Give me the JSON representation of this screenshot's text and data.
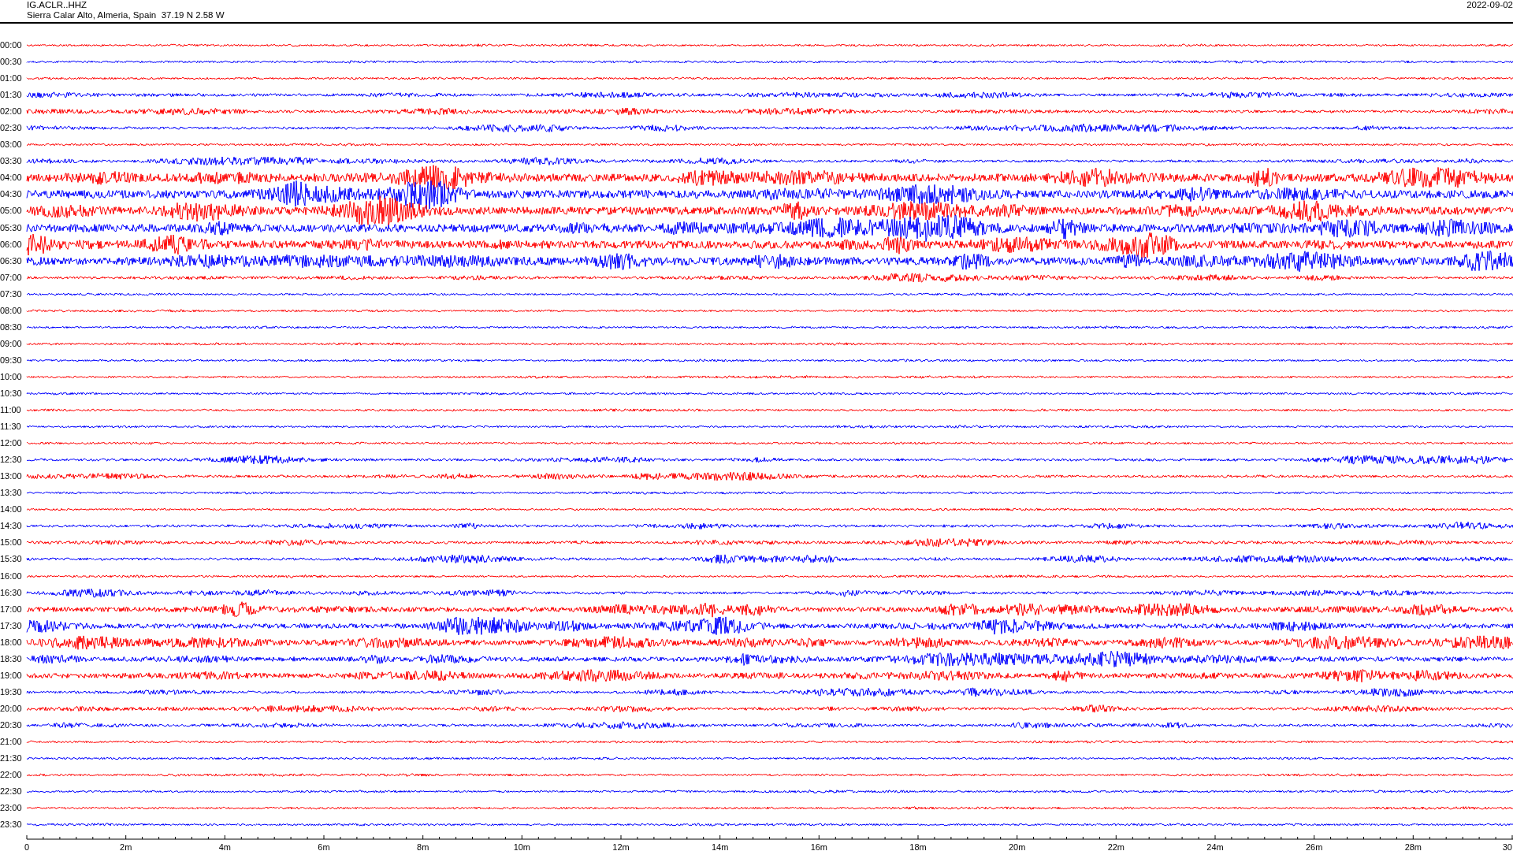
{
  "header": {
    "station": "IG.ACLR..HHZ",
    "location": "Sierra Calar Alto, Almeria, Spain  37.19 N 2.58 W",
    "date": "2022-09-02"
  },
  "traces": [
    {
      "label": "00:00",
      "color": "#ff0000",
      "kind": "quiet"
    },
    {
      "label": "00:30",
      "color": "#0000ff",
      "kind": "quiet"
    },
    {
      "label": "01:00",
      "color": "#ff0000",
      "kind": "quiet"
    },
    {
      "label": "01:30",
      "color": "#0000ff",
      "kind": "light"
    },
    {
      "label": "02:00",
      "color": "#ff0000",
      "kind": "light"
    },
    {
      "label": "02:30",
      "color": "#0000ff",
      "kind": "light"
    },
    {
      "label": "03:00",
      "color": "#ff0000",
      "kind": "quiet"
    },
    {
      "label": "03:30",
      "color": "#0000ff",
      "kind": "light"
    },
    {
      "label": "04:00",
      "color": "#ff0000",
      "kind": "strong"
    },
    {
      "label": "04:30",
      "color": "#0000ff",
      "kind": "strong"
    },
    {
      "label": "05:00",
      "color": "#ff0000",
      "kind": "strong"
    },
    {
      "label": "05:30",
      "color": "#0000ff",
      "kind": "strong"
    },
    {
      "label": "06:00",
      "color": "#ff0000",
      "kind": "strong"
    },
    {
      "label": "06:30",
      "color": "#0000ff",
      "kind": "strong"
    },
    {
      "label": "07:00",
      "color": "#ff0000",
      "kind": "light"
    },
    {
      "label": "07:30",
      "color": "#0000ff",
      "kind": "quiet"
    },
    {
      "label": "08:00",
      "color": "#ff0000",
      "kind": "quiet"
    },
    {
      "label": "08:30",
      "color": "#0000ff",
      "kind": "quiet"
    },
    {
      "label": "09:00",
      "color": "#ff0000",
      "kind": "quiet"
    },
    {
      "label": "09:30",
      "color": "#0000ff",
      "kind": "quiet"
    },
    {
      "label": "10:00",
      "color": "#ff0000",
      "kind": "quiet"
    },
    {
      "label": "10:30",
      "color": "#0000ff",
      "kind": "quiet"
    },
    {
      "label": "11:00",
      "color": "#ff0000",
      "kind": "quiet"
    },
    {
      "label": "11:30",
      "color": "#0000ff",
      "kind": "quiet"
    },
    {
      "label": "12:00",
      "color": "#ff0000",
      "kind": "quiet"
    },
    {
      "label": "12:30",
      "color": "#0000ff",
      "kind": "light"
    },
    {
      "label": "13:00",
      "color": "#ff0000",
      "kind": "light"
    },
    {
      "label": "13:30",
      "color": "#0000ff",
      "kind": "quiet"
    },
    {
      "label": "14:00",
      "color": "#ff0000",
      "kind": "quiet"
    },
    {
      "label": "14:30",
      "color": "#0000ff",
      "kind": "light"
    },
    {
      "label": "15:00",
      "color": "#ff0000",
      "kind": "light"
    },
    {
      "label": "15:30",
      "color": "#0000ff",
      "kind": "light"
    },
    {
      "label": "16:00",
      "color": "#ff0000",
      "kind": "quiet"
    },
    {
      "label": "16:30",
      "color": "#0000ff",
      "kind": "light"
    },
    {
      "label": "17:00",
      "color": "#ff0000",
      "kind": "active"
    },
    {
      "label": "17:30",
      "color": "#0000ff",
      "kind": "active"
    },
    {
      "label": "18:00",
      "color": "#ff0000",
      "kind": "active"
    },
    {
      "label": "18:30",
      "color": "#0000ff",
      "kind": "active"
    },
    {
      "label": "19:00",
      "color": "#ff0000",
      "kind": "active"
    },
    {
      "label": "19:30",
      "color": "#0000ff",
      "kind": "light"
    },
    {
      "label": "20:00",
      "color": "#ff0000",
      "kind": "light"
    },
    {
      "label": "20:30",
      "color": "#0000ff",
      "kind": "light"
    },
    {
      "label": "21:00",
      "color": "#ff0000",
      "kind": "quiet"
    },
    {
      "label": "21:30",
      "color": "#0000ff",
      "kind": "quiet"
    },
    {
      "label": "22:00",
      "color": "#ff0000",
      "kind": "quiet"
    },
    {
      "label": "22:30",
      "color": "#0000ff",
      "kind": "quiet"
    },
    {
      "label": "23:00",
      "color": "#ff0000",
      "kind": "quiet"
    },
    {
      "label": "23:30",
      "color": "#0000ff",
      "kind": "quiet"
    }
  ],
  "x_axis": {
    "labels": [
      "0",
      "2m",
      "4m",
      "6m",
      "8m",
      "10m",
      "12m",
      "14m",
      "16m",
      "18m",
      "20m",
      "22m",
      "24m",
      "26m",
      "28m",
      "30"
    ]
  }
}
